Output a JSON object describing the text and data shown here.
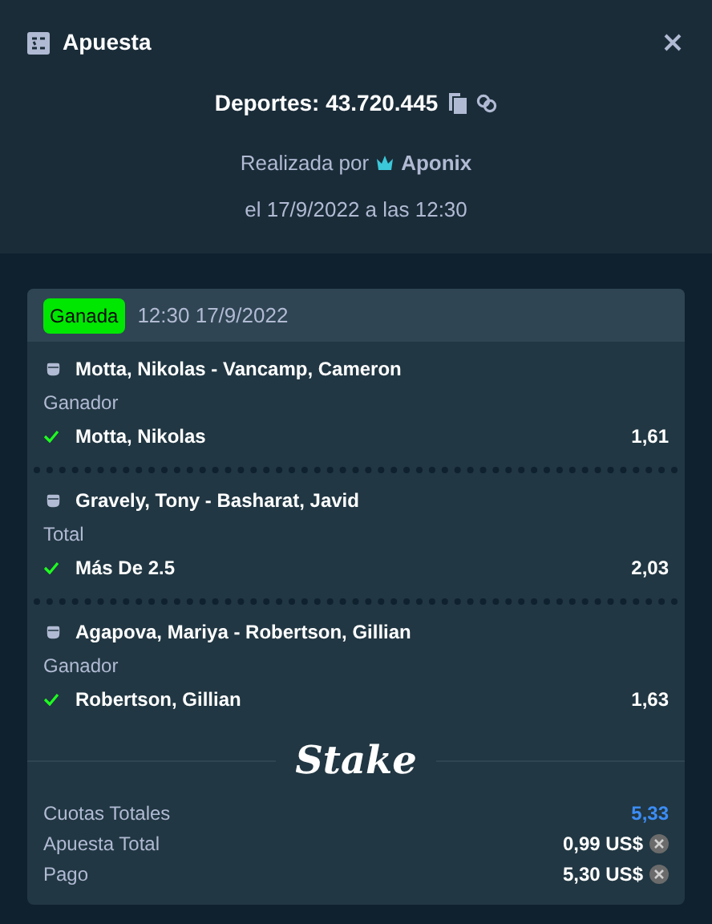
{
  "window": {
    "title": "Apuesta"
  },
  "bet": {
    "label": "Deportes: 43.720.445",
    "placed_by_prefix": "Realizada por",
    "user": "Aponix",
    "date": "el 17/9/2022 a las 12:30"
  },
  "slip": {
    "status": "Ganada",
    "won": true,
    "time": "12:30 17/9/2022",
    "legs": [
      {
        "event": "Motta, Nikolas - Vancamp, Cameron",
        "market": "Ganador",
        "outcome": "Motta, Nikolas",
        "odds": "1,61",
        "won": true
      },
      {
        "event": "Gravely, Tony - Basharat, Javid",
        "market": "Total",
        "outcome": "Más De 2.5",
        "odds": "2,03",
        "won": true
      },
      {
        "event": "Agapova, Mariya - Robertson, Gillian",
        "market": "Ganador",
        "outcome": "Robertson, Gillian",
        "odds": "1,63",
        "won": true
      }
    ],
    "brand": "Stake",
    "totals": [
      {
        "label": "Cuotas Totales",
        "value": "5,33",
        "kind": "odds"
      },
      {
        "label": "Apuesta Total",
        "value": "0,99 US$",
        "kind": "money"
      },
      {
        "label": "Pago",
        "value": "5,30 US$",
        "kind": "money"
      }
    ]
  }
}
